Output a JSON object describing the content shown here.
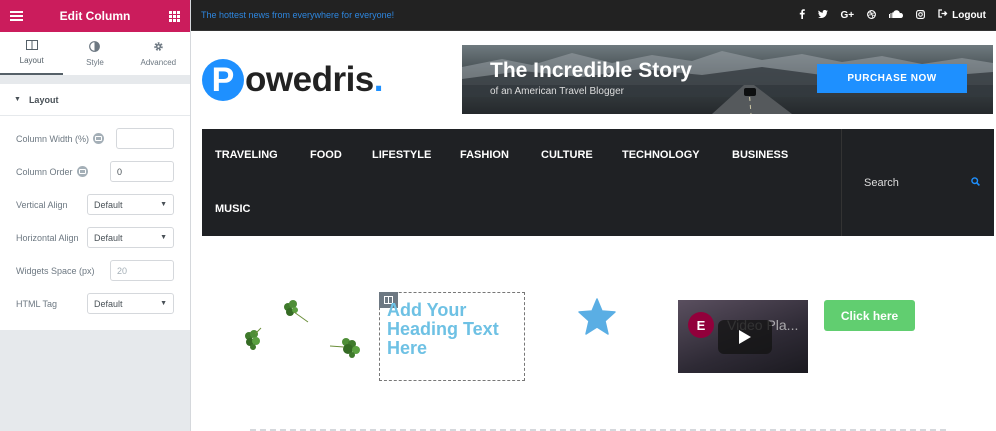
{
  "panel": {
    "title": "Edit Column",
    "tabs": [
      {
        "label": "Layout",
        "icon": "layout-icon"
      },
      {
        "label": "Style",
        "icon": "style-icon"
      },
      {
        "label": "Advanced",
        "icon": "gear-icon"
      }
    ],
    "section_title": "Layout",
    "controls": {
      "column_width": {
        "label": "Column Width (%)",
        "value": ""
      },
      "column_order": {
        "label": "Column Order",
        "value": "0"
      },
      "vertical_align": {
        "label": "Vertical Align",
        "value": "Default"
      },
      "horizontal_align": {
        "label": "Horizontal Align",
        "value": "Default"
      },
      "widgets_space": {
        "label": "Widgets Space (px)",
        "placeholder": "20"
      },
      "html_tag": {
        "label": "HTML Tag",
        "value": "Default"
      }
    },
    "accent_color": "#cb1c5c"
  },
  "site": {
    "tagline": "The hottest news from everywhere for everyone!",
    "social_icons": [
      "facebook-icon",
      "twitter-icon",
      "google-plus-icon",
      "dribbble-icon",
      "soundcloud-icon",
      "instagram-icon"
    ],
    "logout_label": "Logout",
    "logo": {
      "letter": "P",
      "rest": "owedris",
      "dot": "."
    },
    "banner": {
      "title": "The Incredible Story",
      "subtitle": "of an American Travel Blogger",
      "button": "PURCHASE NOW"
    },
    "nav": {
      "items": [
        "TRAVELING",
        "FOOD",
        "LIFESTYLE",
        "FASHION",
        "CULTURE",
        "TECHNOLOGY",
        "BUSINESS",
        "MUSIC"
      ],
      "search_label": "Search"
    },
    "content": {
      "heading": "Add Your Heading Text Here",
      "video_title": "Video Pla...",
      "button_label": "Click here"
    },
    "brand_color": "#1e90ff",
    "heading_color": "#6ec1e4",
    "button_color": "#61ce70"
  }
}
